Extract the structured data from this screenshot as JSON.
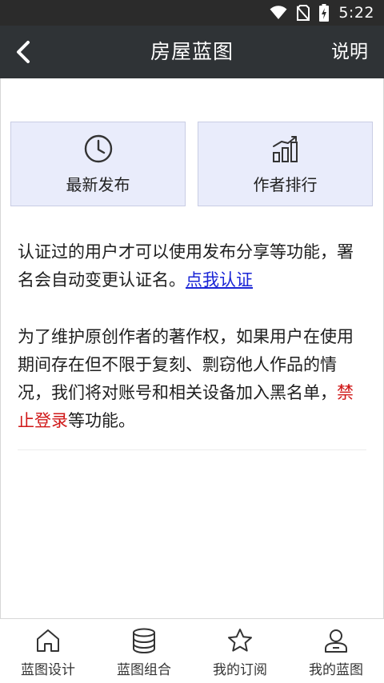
{
  "status_bar": {
    "time": "5:22",
    "icons": [
      "wifi-icon",
      "no-sim-icon",
      "battery-charging-icon"
    ]
  },
  "header": {
    "back_icon": "back-arrow-icon",
    "title": "房屋蓝图",
    "help_label": "说明"
  },
  "actions": [
    {
      "icon": "clock-icon",
      "label": "最新发布"
    },
    {
      "icon": "bar-chart-icon",
      "label": "作者排行"
    }
  ],
  "notice": {
    "paragraph1_text": "认证过的用户才可以使用发布分享等功能，署名会自动变更认证名。",
    "paragraph1_link": "点我认证",
    "paragraph2_prefix": "为了维护原创作者的著作权，如果用户在使用期间存在但不限于复刻、剽窃他人作品的情况，我们将对账号和相关设备加入黑名单，",
    "paragraph2_highlight": "禁止登录",
    "paragraph2_suffix": "等功能。",
    "highlight_color": "#d01818",
    "link_color": "#1a25d6"
  },
  "bottom_nav": [
    {
      "icon": "home-icon",
      "label": "蓝图设计"
    },
    {
      "icon": "database-icon",
      "label": "蓝图组合"
    },
    {
      "icon": "star-icon",
      "label": "我的订阅"
    },
    {
      "icon": "user-icon",
      "label": "我的蓝图"
    }
  ],
  "colors": {
    "status_bar": "#2b2b2b",
    "title_bar": "#2f3336",
    "card_background": "#e9ecfb"
  }
}
